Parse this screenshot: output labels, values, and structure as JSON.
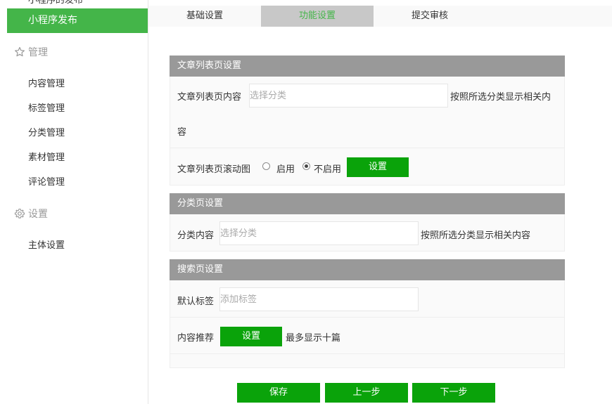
{
  "sidebar": {
    "cut_off_item": "小程序的发布",
    "active_item": "小程序发布",
    "groups": [
      {
        "label": "管理",
        "icon": "star-icon",
        "items": [
          "内容管理",
          "标签管理",
          "分类管理",
          "素材管理",
          "评论管理"
        ]
      },
      {
        "label": "设置",
        "icon": "gear-icon",
        "items": [
          "主体设置"
        ]
      }
    ]
  },
  "tabs": [
    {
      "label": "基础设置",
      "active": false
    },
    {
      "label": "功能设置",
      "active": true
    },
    {
      "label": "提交审核",
      "active": false
    }
  ],
  "article_list": {
    "title": "文章列表页设置",
    "content_label": "文章列表页内容",
    "content_placeholder": "选择分类",
    "content_hint": "按照所选分类显示相关内",
    "content_hint_wrap": "容",
    "carousel_label": "文章列表页滚动图",
    "radio_enable": "启用",
    "radio_disable": "不启用",
    "radio_selected": "不启用",
    "settings_button": "设置"
  },
  "category_page": {
    "title": "分类页设置",
    "content_label": "分类内容",
    "content_placeholder": "选择分类",
    "content_hint": "按照所选分类显示相关内容"
  },
  "search_page": {
    "title": "搜索页设置",
    "tag_label": "默认标签",
    "tag_placeholder": "添加标签",
    "recommend_label": "内容推荐",
    "settings_button": "设置",
    "recommend_hint": "最多显示十篇"
  },
  "footer": {
    "save": "保存",
    "prev": "上一步",
    "next": "下一步"
  },
  "colors": {
    "accent_green": "#44b549",
    "button_green": "#0aa30a",
    "panel_header": "#999999"
  }
}
